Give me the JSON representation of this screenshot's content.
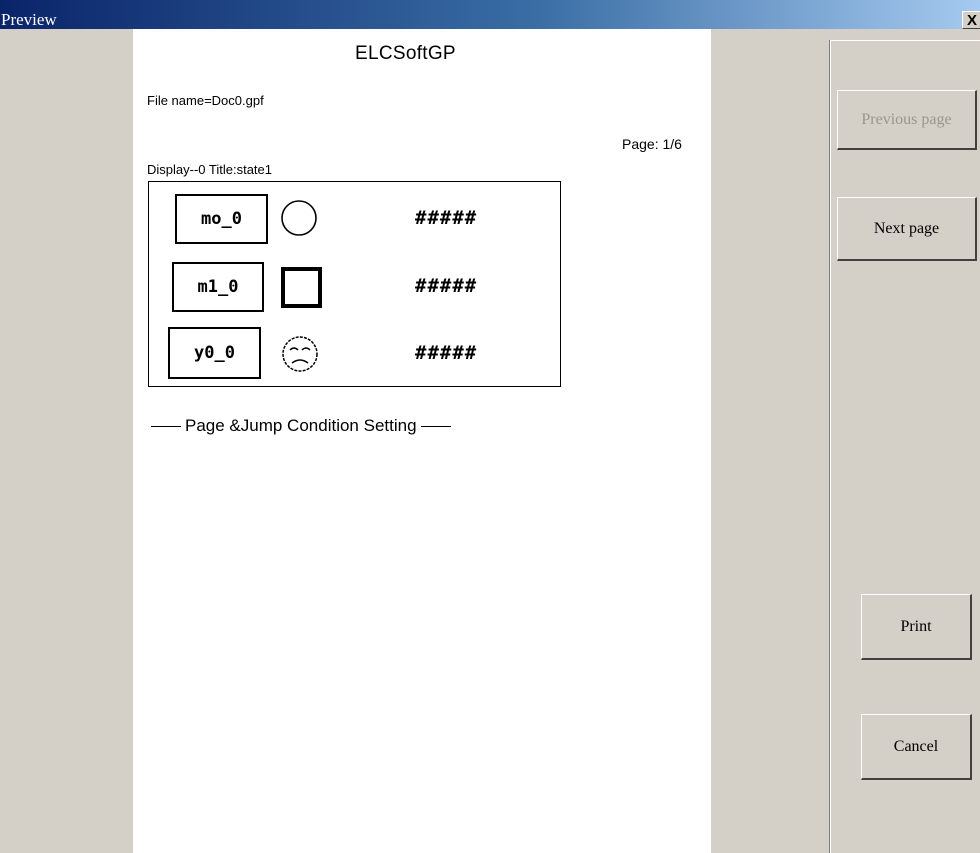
{
  "window": {
    "title": "Preview",
    "close_label": "X"
  },
  "document": {
    "title": "ELCSoftGP",
    "file_name": "File name=Doc0.gpf",
    "page": "Page: 1/6",
    "display_line": "Display--0  Title:state1",
    "rows": [
      {
        "label": "mo_0",
        "shape": "circle",
        "value": "#####"
      },
      {
        "label": "m1_0",
        "shape": "square",
        "value": "#####"
      },
      {
        "label": "y0_0",
        "shape": "sad-face",
        "value": "#####"
      }
    ],
    "section_heading": "Page &Jump Condition Setting"
  },
  "buttons": {
    "previous": "Previous page",
    "next": "Next page",
    "print": "Print",
    "cancel": "Cancel"
  }
}
